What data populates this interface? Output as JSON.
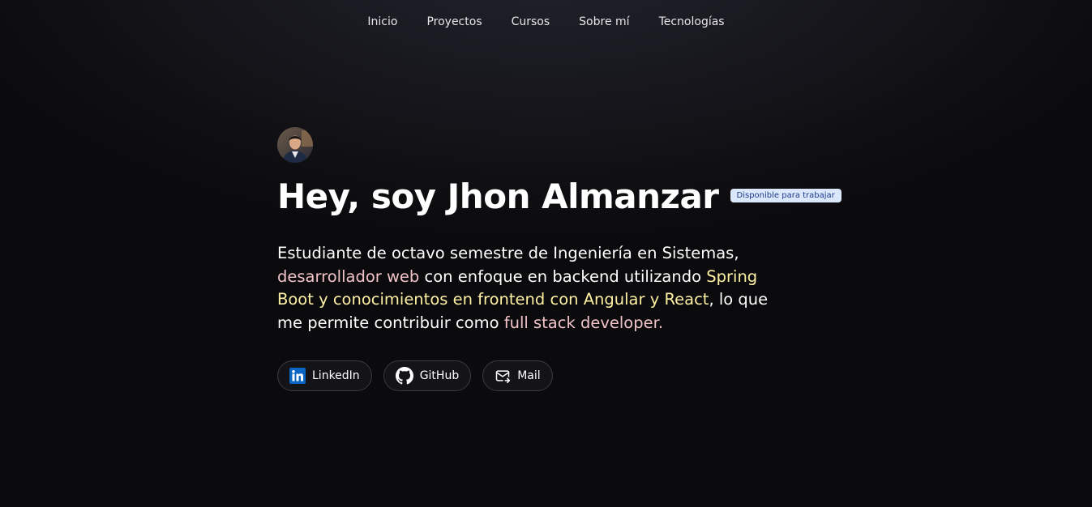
{
  "nav": {
    "items": [
      {
        "label": "Inicio"
      },
      {
        "label": "Proyectos"
      },
      {
        "label": "Cursos"
      },
      {
        "label": "Sobre mí"
      },
      {
        "label": "Tecnologías"
      }
    ]
  },
  "hero": {
    "title": "Hey, soy Jhon Almanzar",
    "badge": "Disponible para trabajar",
    "bio": {
      "part1": "Estudiante de octavo semestre de Ingeniería en Sistemas, ",
      "highlight1": "desarrollador web",
      "part2": " con enfoque en backend utilizando ",
      "highlight2": "Spring Boot y conocimientos en frontend con Angular y React",
      "part3": ", lo que me permite contribuir como ",
      "highlight3": "full stack developer."
    }
  },
  "socials": {
    "linkedin": {
      "label": "LinkedIn",
      "icon": "linkedin-icon"
    },
    "github": {
      "label": "GitHub",
      "icon": "github-icon"
    },
    "mail": {
      "label": "Mail",
      "icon": "mail-icon"
    }
  },
  "colors": {
    "accent_pink": "#f2c3c8",
    "accent_yellow": "#fdf0a3",
    "badge_bg": "#dbe7fb",
    "badge_text": "#1e3a8a",
    "linkedin_blue": "#0a66c2"
  }
}
